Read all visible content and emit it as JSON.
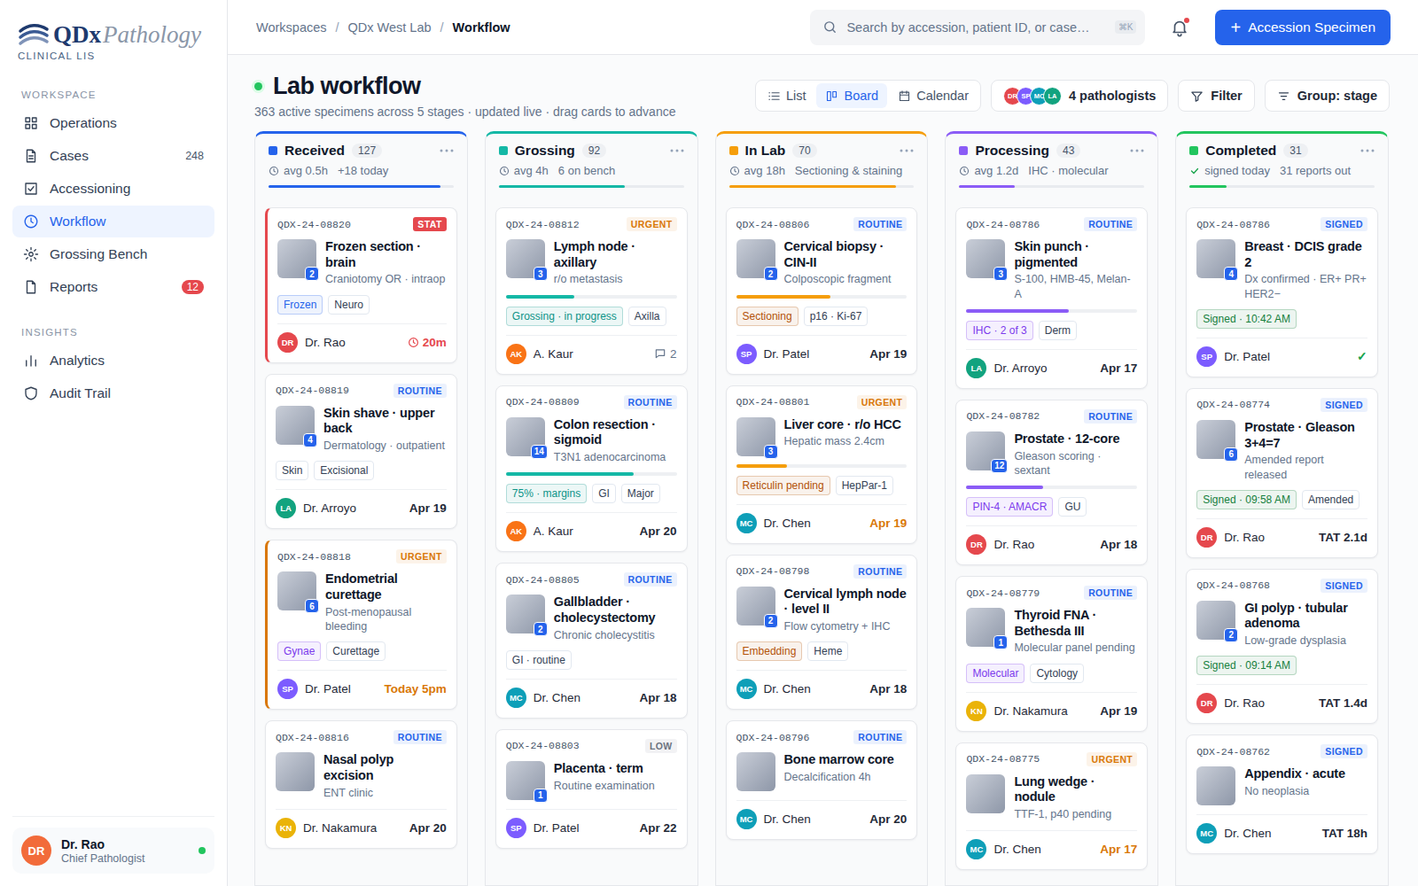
{
  "sidebar": {
    "logo": {
      "brand": "QDx",
      "product": "Pathology",
      "tagline": "CLINICAL LIS"
    },
    "sections": [
      {
        "title": "WORKSPACE",
        "items": [
          {
            "label": "Operations",
            "selected": false
          },
          {
            "label": "Cases",
            "badge": "248",
            "alert": false,
            "selected": false
          },
          {
            "label": "Accessioning",
            "selected": false
          },
          {
            "label": "Workflow",
            "selected": true
          },
          {
            "label": "Grossing Bench",
            "selected": false
          },
          {
            "label": "Reports",
            "badge": "12",
            "alert": true,
            "selected": false
          }
        ]
      },
      {
        "title": "INSIGHTS",
        "items": [
          {
            "label": "Analytics",
            "selected": false
          },
          {
            "label": "Audit Trail",
            "selected": false
          }
        ]
      }
    ],
    "user": {
      "initials": "DR",
      "color": "#f26b3a",
      "name": "Dr. Rao",
      "role": "Chief Pathologist",
      "online": true
    }
  },
  "topbar": {
    "breadcrumb": [
      {
        "label": "Workspaces",
        "current": false
      },
      {
        "label": "QDx West Lab",
        "current": false
      },
      {
        "label": "Workflow",
        "current": true
      }
    ],
    "separator": "/",
    "search": {
      "placeholder": "Search by accession, patient ID, or case…",
      "shortcut": "⌘K"
    },
    "notifications": {
      "unread": true
    },
    "primary_button": {
      "icon": "+",
      "label": "Accession Specimen"
    }
  },
  "header": {
    "live": true,
    "title": "Lab workflow",
    "subtitle": "363 active specimens across 5 stages · updated live · drag cards to advance",
    "views": [
      {
        "label": "List",
        "selected": false
      },
      {
        "label": "Board",
        "selected": true
      },
      {
        "label": "Calendar",
        "selected": false
      }
    ],
    "pathologists": {
      "avatars": [
        {
          "initials": "DR",
          "color": "#e5484d"
        },
        {
          "initials": "SP",
          "color": "#7c5cff"
        },
        {
          "initials": "MC",
          "color": "#0e9fb8"
        },
        {
          "initials": "LA",
          "color": "#12a37f"
        }
      ],
      "label": "4 pathologists"
    },
    "filter": "Filter",
    "group": "Group: stage"
  },
  "columns": [
    {
      "name": "Received",
      "count": "127",
      "color": "#2563eb",
      "done": false,
      "meta": [
        "avg 0.5h",
        "+18 today"
      ],
      "level": 0.93,
      "cards": [
        {
          "id": "QDX-24-08820",
          "badge": {
            "text": "STAT",
            "color": "#e5484d",
            "filled": true
          },
          "accent": true,
          "thumb_count": "2",
          "title": "Frozen section · brain",
          "subtitle": "Craniotomy OR · intraop",
          "tags": [
            {
              "label": "Frozen",
              "color": "#2563eb"
            },
            {
              "label": "Neuro"
            }
          ],
          "assignee": {
            "initials": "DR",
            "color": "#e5484d",
            "name": "Dr. Rao"
          },
          "meta": {
            "kind": "timer",
            "text": "20m",
            "color": "#e5484d"
          }
        },
        {
          "id": "QDX-24-08819",
          "badge": {
            "text": "ROUTINE",
            "color": "#2563eb",
            "filled": false
          },
          "accent": false,
          "thumb_count": "4",
          "title": "Skin shave · upper back",
          "subtitle": "Dermatology · outpatient",
          "tags": [
            {
              "label": "Skin"
            },
            {
              "label": "Excisional"
            }
          ],
          "assignee": {
            "initials": "LA",
            "color": "#12a37f",
            "name": "Dr. Arroyo"
          },
          "meta": {
            "kind": "date",
            "text": "Apr 19",
            "color": "#1f2937"
          }
        },
        {
          "id": "QDX-24-08818",
          "badge": {
            "text": "URGENT",
            "color": "#d97706",
            "filled": false
          },
          "accent": true,
          "thumb_count": "6",
          "title": "Endometrial curettage",
          "subtitle": "Post-menopausal bleeding",
          "tags": [
            {
              "label": "Gynae",
              "color": "#7c3aed"
            },
            {
              "label": "Curettage"
            }
          ],
          "assignee": {
            "initials": "SP",
            "color": "#7c5cff",
            "name": "Dr. Patel"
          },
          "meta": {
            "kind": "date",
            "text": "Today 5pm",
            "color": "#d97706"
          }
        },
        {
          "id": "QDX-24-08816",
          "badge": {
            "text": "ROUTINE",
            "color": "#2563eb",
            "filled": false
          },
          "accent": false,
          "title": "Nasal polyp excision",
          "subtitle": "ENT clinic",
          "tags": [],
          "assignee": {
            "initials": "KN",
            "color": "#eab308",
            "name": "Dr. Nakamura"
          },
          "meta": {
            "kind": "date",
            "text": "Apr 20",
            "color": "#1f2937"
          }
        }
      ]
    },
    {
      "name": "Grossing",
      "count": "92",
      "color": "#14b8a6",
      "done": false,
      "meta": [
        "avg 4h",
        "6 on bench"
      ],
      "level": 0.68,
      "cards": [
        {
          "id": "QDX-24-08812",
          "badge": {
            "text": "URGENT",
            "color": "#d97706",
            "filled": false
          },
          "accent": false,
          "thumb_count": "3",
          "title": "Lymph node · axillary",
          "subtitle": "r/o metastasis",
          "level": 0.4,
          "tags": [
            {
              "label": "Grossing · in progress",
              "color": "#0d9488"
            },
            {
              "label": "Axilla"
            }
          ],
          "assignee": {
            "initials": "AK",
            "color": "#f97316",
            "name": "A. Kaur"
          },
          "meta": {
            "kind": "comments",
            "text": "2",
            "color": "#64748b"
          }
        },
        {
          "id": "QDX-24-08809",
          "badge": {
            "text": "ROUTINE",
            "color": "#2563eb",
            "filled": false
          },
          "accent": false,
          "thumb_count": "14",
          "title": "Colon resection · sigmoid",
          "subtitle": "T3N1 adenocarcinoma",
          "level": 0.75,
          "tags": [
            {
              "label": "75% · margins",
              "color": "#0d9488"
            },
            {
              "label": "GI"
            },
            {
              "label": "Major"
            }
          ],
          "assignee": {
            "initials": "AK",
            "color": "#f97316",
            "name": "A. Kaur"
          },
          "meta": {
            "kind": "date",
            "text": "Apr 20",
            "color": "#1f2937"
          }
        },
        {
          "id": "QDX-24-08805",
          "badge": {
            "text": "ROUTINE",
            "color": "#2563eb",
            "filled": false
          },
          "accent": false,
          "thumb_count": "2",
          "title": "Gallbladder · cholecystectomy",
          "subtitle": "Chronic cholecystitis",
          "tags": [
            {
              "label": "GI · routine"
            }
          ],
          "assignee": {
            "initials": "MC",
            "color": "#0e9fb8",
            "name": "Dr. Chen"
          },
          "meta": {
            "kind": "date",
            "text": "Apr 18",
            "color": "#1f2937"
          }
        },
        {
          "id": "QDX-24-08803",
          "badge": {
            "text": "LOW",
            "color": "#6b7280",
            "filled": false
          },
          "accent": false,
          "thumb_count": "1",
          "title": "Placenta · term",
          "subtitle": "Routine examination",
          "tags": [],
          "assignee": {
            "initials": "SP",
            "color": "#7c5cff",
            "name": "Dr. Patel"
          },
          "meta": {
            "kind": "date",
            "text": "Apr 22",
            "color": "#1f2937"
          }
        }
      ]
    },
    {
      "name": "In Lab",
      "count": "70",
      "color": "#f59e0b",
      "done": false,
      "meta": [
        "avg 18h",
        "Sectioning & staining"
      ],
      "level": 0.9,
      "cards": [
        {
          "id": "QDX-24-08806",
          "badge": {
            "text": "ROUTINE",
            "color": "#2563eb",
            "filled": false
          },
          "accent": false,
          "thumb_count": "2",
          "title": "Cervical biopsy · CIN-II",
          "subtitle": "Colposcopic fragment",
          "level": 0.55,
          "tags": [
            {
              "label": "Sectioning",
              "color": "#b45309"
            },
            {
              "label": "p16 · Ki-67"
            }
          ],
          "assignee": {
            "initials": "SP",
            "color": "#7c5cff",
            "name": "Dr. Patel"
          },
          "meta": {
            "kind": "date",
            "text": "Apr 19",
            "color": "#1f2937"
          }
        },
        {
          "id": "QDX-24-08801",
          "badge": {
            "text": "URGENT",
            "color": "#d97706",
            "filled": false
          },
          "accent": false,
          "thumb_count": "3",
          "title": "Liver core · r/o HCC",
          "subtitle": "Hepatic mass 2.4cm",
          "level": 0.3,
          "tags": [
            {
              "label": "Reticulin pending",
              "color": "#b45309"
            },
            {
              "label": "HepPar-1"
            }
          ],
          "assignee": {
            "initials": "MC",
            "color": "#0e9fb8",
            "name": "Dr. Chen"
          },
          "meta": {
            "kind": "date",
            "text": "Apr 19",
            "color": "#d97706"
          }
        },
        {
          "id": "QDX-24-08798",
          "badge": {
            "text": "ROUTINE",
            "color": "#2563eb",
            "filled": false
          },
          "accent": false,
          "thumb_count": "2",
          "title": "Cervical lymph node · level II",
          "subtitle": "Flow cytometry + IHC",
          "tags": [
            {
              "label": "Embedding",
              "color": "#b45309"
            },
            {
              "label": "Heme"
            }
          ],
          "assignee": {
            "initials": "MC",
            "color": "#0e9fb8",
            "name": "Dr. Chen"
          },
          "meta": {
            "kind": "date",
            "text": "Apr 18",
            "color": "#1f2937"
          }
        },
        {
          "id": "QDX-24-08796",
          "badge": {
            "text": "ROUTINE",
            "color": "#2563eb",
            "filled": false
          },
          "accent": false,
          "title": "Bone marrow core",
          "subtitle": "Decalcification 4h",
          "tags": [],
          "assignee": {
            "initials": "MC",
            "color": "#0e9fb8",
            "name": "Dr. Chen"
          },
          "meta": {
            "kind": "date",
            "text": "Apr 20",
            "color": "#1f2937"
          }
        }
      ]
    },
    {
      "name": "Processing",
      "count": "43",
      "color": "#8b5cf6",
      "done": false,
      "meta": [
        "avg 1.2d",
        "IHC · molecular"
      ],
      "level": 0.3,
      "cards": [
        {
          "id": "QDX-24-08786",
          "badge": {
            "text": "ROUTINE",
            "color": "#2563eb",
            "filled": false
          },
          "accent": false,
          "thumb_count": "3",
          "title": "Skin punch · pigmented",
          "subtitle": "S-100, HMB-45, Melan-A",
          "level": 0.6,
          "tags": [
            {
              "label": "IHC · 2 of 3",
              "color": "#7c3aed"
            },
            {
              "label": "Derm"
            }
          ],
          "assignee": {
            "initials": "LA",
            "color": "#12a37f",
            "name": "Dr. Arroyo"
          },
          "meta": {
            "kind": "date",
            "text": "Apr 17",
            "color": "#1f2937"
          }
        },
        {
          "id": "QDX-24-08782",
          "badge": {
            "text": "ROUTINE",
            "color": "#2563eb",
            "filled": false
          },
          "accent": false,
          "thumb_count": "12",
          "title": "Prostate · 12-core",
          "subtitle": "Gleason scoring · sextant",
          "level": 0.45,
          "tags": [
            {
              "label": "PIN-4 · AMACR",
              "color": "#7c3aed"
            },
            {
              "label": "GU"
            }
          ],
          "assignee": {
            "initials": "DR",
            "color": "#e5484d",
            "name": "Dr. Rao"
          },
          "meta": {
            "kind": "date",
            "text": "Apr 18",
            "color": "#1f2937"
          }
        },
        {
          "id": "QDX-24-08779",
          "badge": {
            "text": "ROUTINE",
            "color": "#2563eb",
            "filled": false
          },
          "accent": false,
          "thumb_count": "1",
          "title": "Thyroid FNA · Bethesda III",
          "subtitle": "Molecular panel pending",
          "tags": [
            {
              "label": "Molecular",
              "color": "#7c3aed"
            },
            {
              "label": "Cytology"
            }
          ],
          "assignee": {
            "initials": "KN",
            "color": "#eab308",
            "name": "Dr. Nakamura"
          },
          "meta": {
            "kind": "date",
            "text": "Apr 19",
            "color": "#1f2937"
          }
        },
        {
          "id": "QDX-24-08775",
          "badge": {
            "text": "URGENT",
            "color": "#d97706",
            "filled": false
          },
          "accent": false,
          "title": "Lung wedge · nodule",
          "subtitle": "TTF-1, p40 pending",
          "tags": [],
          "assignee": {
            "initials": "MC",
            "color": "#0e9fb8",
            "name": "Dr. Chen"
          },
          "meta": {
            "kind": "date",
            "text": "Apr 17",
            "color": "#d97706"
          }
        }
      ]
    },
    {
      "name": "Completed",
      "count": "31",
      "color": "#22c55e",
      "done": true,
      "meta": [
        "signed today",
        "31 reports out"
      ],
      "level": 0.2,
      "cards": [
        {
          "id": "QDX-24-08786",
          "badge": {
            "text": "SIGNED",
            "color": "#2563eb",
            "filled": false
          },
          "accent": false,
          "thumb_count": "4",
          "title": "Breast · DCIS grade 2",
          "subtitle": "Dx confirmed · ER+ PR+ HER2−",
          "tags": [
            {
              "label": "Signed · 10:42 AM",
              "color": "#15803d"
            }
          ],
          "assignee": {
            "initials": "SP",
            "color": "#7c5cff",
            "name": "Dr. Patel"
          },
          "meta": {
            "kind": "check",
            "text": "✓",
            "color": "#16a34a"
          }
        },
        {
          "id": "QDX-24-08774",
          "badge": {
            "text": "SIGNED",
            "color": "#2563eb",
            "filled": false
          },
          "accent": false,
          "thumb_count": "6",
          "title": "Prostate · Gleason 3+4=7",
          "subtitle": "Amended report released",
          "tags": [
            {
              "label": "Signed · 09:58 AM",
              "color": "#15803d"
            },
            {
              "label": "Amended"
            }
          ],
          "assignee": {
            "initials": "DR",
            "color": "#e5484d",
            "name": "Dr. Rao"
          },
          "meta": {
            "kind": "tat",
            "text": "TAT 2.1d",
            "color": "#1f2937"
          }
        },
        {
          "id": "QDX-24-08768",
          "badge": {
            "text": "SIGNED",
            "color": "#2563eb",
            "filled": false
          },
          "accent": false,
          "thumb_count": "2",
          "title": "GI polyp · tubular adenoma",
          "subtitle": "Low-grade dysplasia",
          "tags": [
            {
              "label": "Signed · 09:14 AM",
              "color": "#15803d"
            }
          ],
          "assignee": {
            "initials": "DR",
            "color": "#e5484d",
            "name": "Dr. Rao"
          },
          "meta": {
            "kind": "tat",
            "text": "TAT 1.4d",
            "color": "#1f2937"
          }
        },
        {
          "id": "QDX-24-08762",
          "badge": {
            "text": "SIGNED",
            "color": "#2563eb",
            "filled": false
          },
          "accent": false,
          "title": "Appendix · acute",
          "subtitle": "No neoplasia",
          "tags": [],
          "assignee": {
            "initials": "MC",
            "color": "#0e9fb8",
            "name": "Dr. Chen"
          },
          "meta": {
            "kind": "tat",
            "text": "TAT 18h",
            "color": "#1f2937"
          }
        }
      ]
    }
  ]
}
